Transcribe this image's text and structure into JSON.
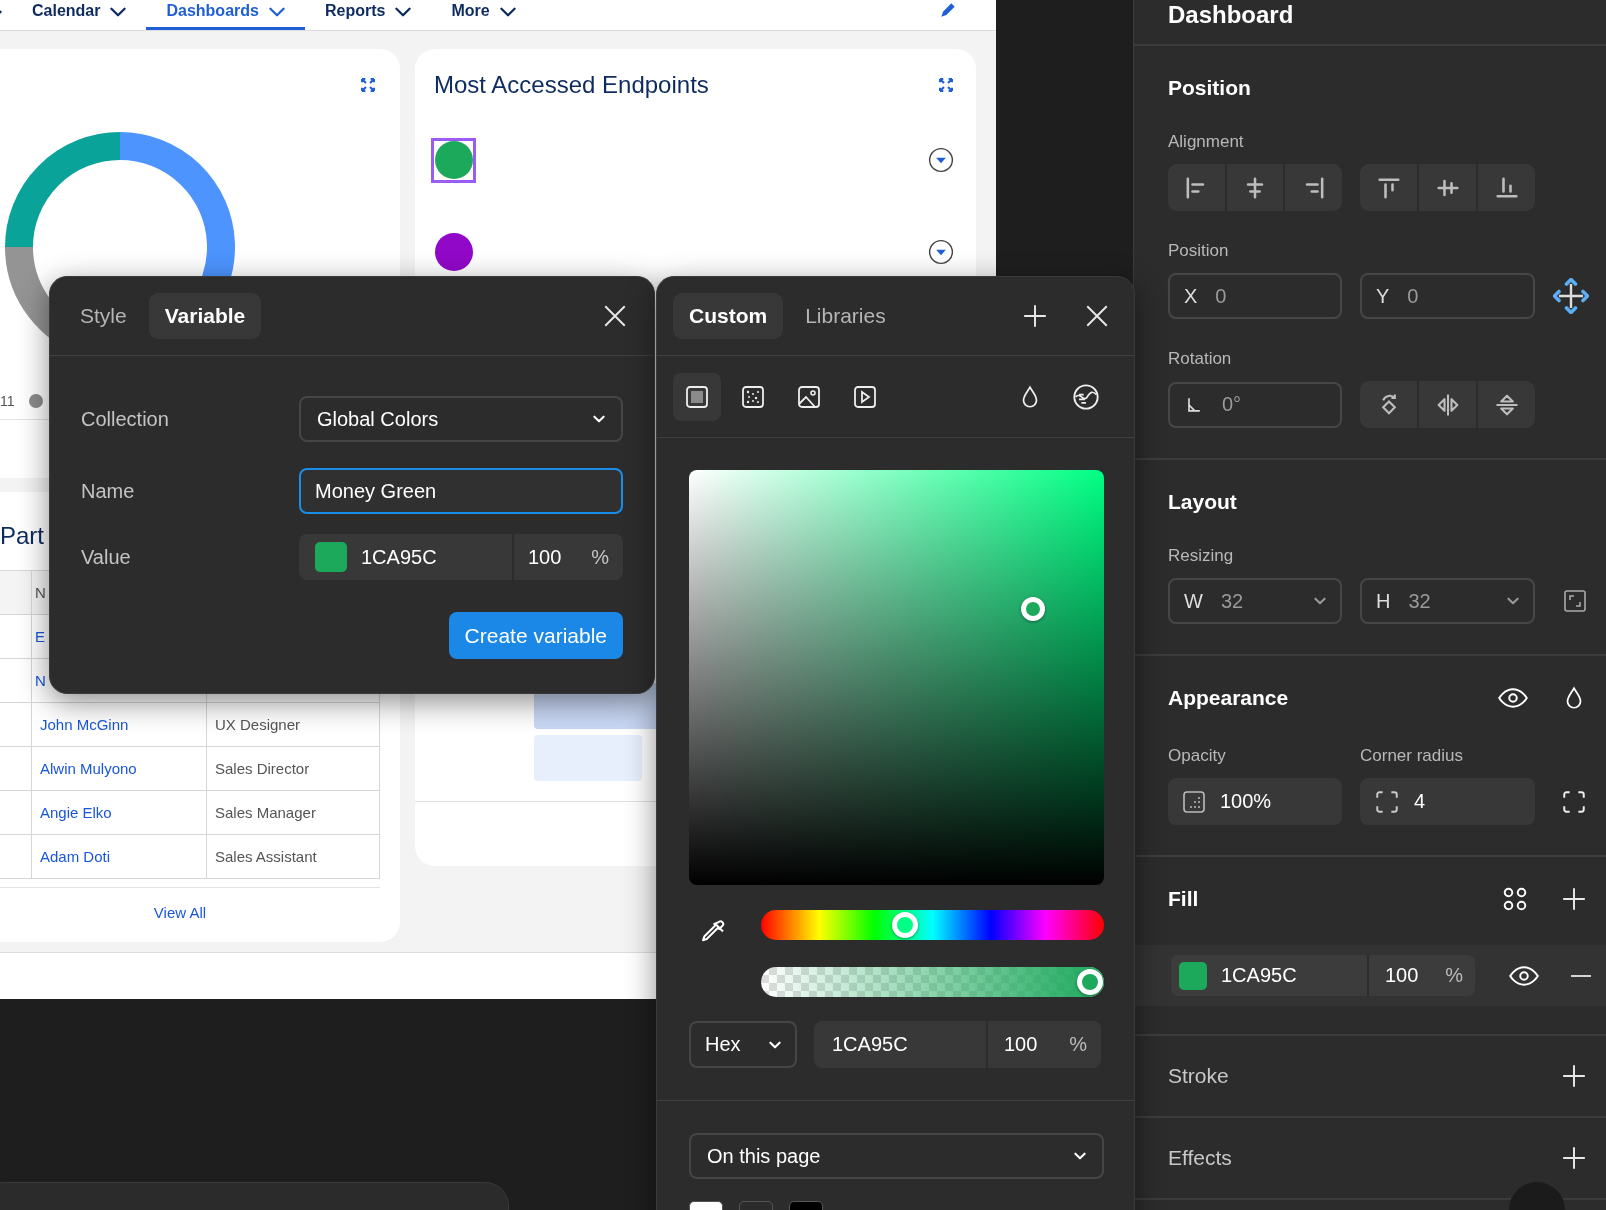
{
  "nav": {
    "tabs": [
      {
        "label": "Calendar",
        "selected": false
      },
      {
        "label": "Dashboards",
        "selected": true
      },
      {
        "label": "Reports",
        "selected": false
      },
      {
        "label": "More",
        "selected": false
      }
    ]
  },
  "chart_card": {
    "legend_text": "11"
  },
  "partners_card": {
    "title": "Part",
    "header": [
      "N"
    ],
    "rows": [
      [
        "E"
      ],
      [
        "N"
      ],
      [
        "John McGinn",
        "UX Designer"
      ],
      [
        "Alwin Mulyono",
        "Sales Director"
      ],
      [
        "Angie Elko",
        "Sales Manager"
      ],
      [
        "Adam Doti",
        "Sales Assistant"
      ]
    ],
    "link": "View All"
  },
  "endpoints_card": {
    "title": "Most Accessed Endpoints",
    "items": [
      {
        "color": "#1ca95c",
        "selected": true
      },
      {
        "color": "#9208c8",
        "selected": false
      }
    ]
  },
  "variable_dialog": {
    "tabs": [
      {
        "label": "Style",
        "selected": false
      },
      {
        "label": "Variable",
        "selected": true
      }
    ],
    "fields": [
      {
        "label": "Collection",
        "kind": "dropdown",
        "value": "Global Colors"
      },
      {
        "label": "Name",
        "kind": "input",
        "value": "Money Green"
      },
      {
        "label": "Value",
        "kind": "color",
        "value": "1CA95C",
        "opacity": "100",
        "unit": "%",
        "color": "#1ca95c"
      }
    ],
    "button": "Create variable"
  },
  "color_picker": {
    "tabs": [
      {
        "label": "Custom",
        "selected": true
      },
      {
        "label": "Libraries",
        "selected": false
      }
    ],
    "fill_types": [
      {
        "kind": "solid",
        "selected": true
      },
      {
        "kind": "noise",
        "selected": false
      },
      {
        "kind": "image",
        "selected": false
      },
      {
        "kind": "video",
        "selected": false
      }
    ],
    "hue": {
      "level": 0.42
    },
    "alpha": {
      "level": 1
    },
    "format": "Hex",
    "hex": "1CA95C",
    "opacity": "100",
    "unit": "%",
    "scope": "On this page",
    "swatches": [
      {
        "color": "#ffffff"
      },
      {
        "color": "#2b2b2b"
      },
      {
        "color": "#000000"
      }
    ]
  },
  "inspector": {
    "title": "Dashboard",
    "position": {
      "title": "Position",
      "alignment_label": "Alignment",
      "position_label": "Position",
      "x": {
        "prefix": "X",
        "value": "0"
      },
      "y": {
        "prefix": "Y",
        "value": "0"
      },
      "rotation_label": "Rotation",
      "rotation": "0°"
    },
    "layout": {
      "title": "Layout",
      "resizing_label": "Resizing",
      "w": {
        "prefix": "W",
        "value": "32"
      },
      "h": {
        "prefix": "H",
        "value": "32"
      }
    },
    "appearance": {
      "title": "Appearance",
      "opacity_label": "Opacity",
      "opacity": "100%",
      "radius_label": "Corner radius",
      "radius": "4"
    },
    "fill": {
      "title": "Fill",
      "hex": "1CA95C",
      "opacity": "100",
      "unit": "%",
      "color": "#1ca95c"
    },
    "stroke": {
      "title": "Stroke"
    },
    "effects": {
      "title": "Effects"
    }
  }
}
